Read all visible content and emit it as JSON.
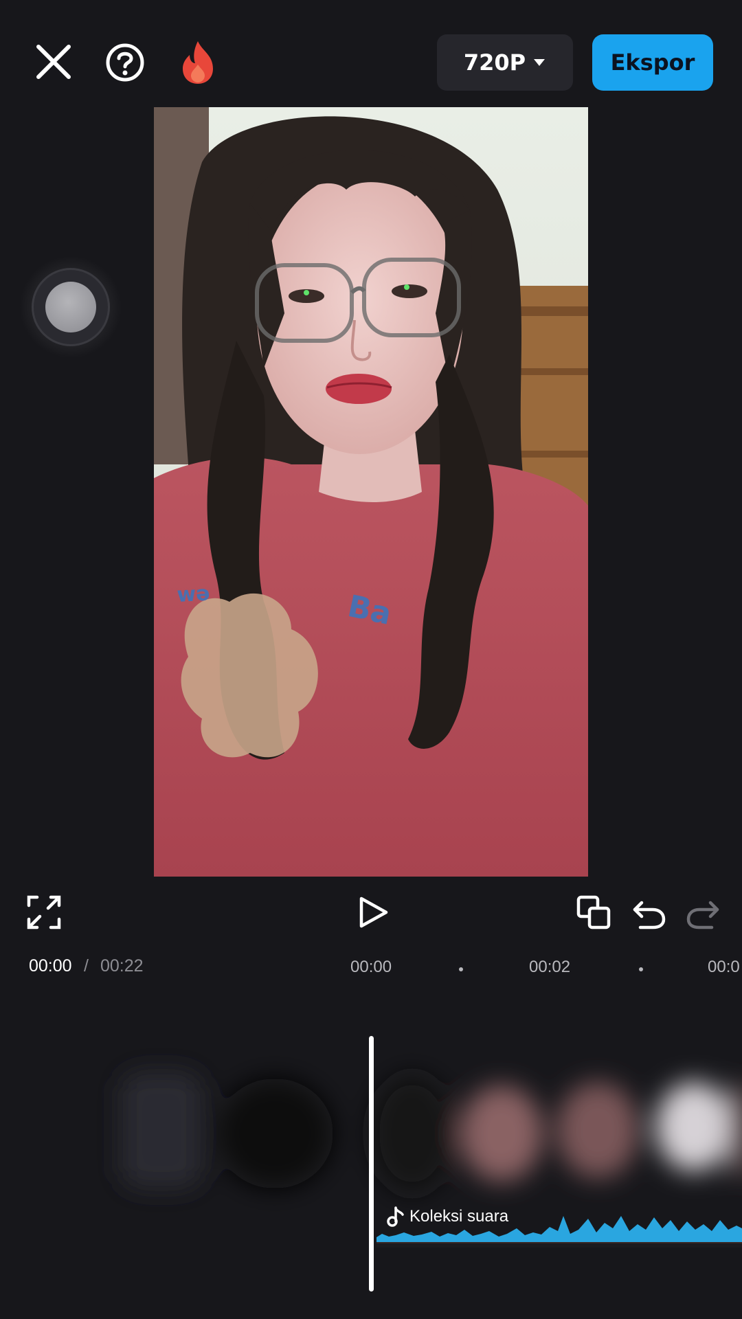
{
  "toolbar": {
    "resolution_label": "720P",
    "export_label": "Ekspor"
  },
  "icons": {
    "close": "close-icon",
    "help": "help-icon",
    "flame": "flame-icon",
    "dropdown": "chevron-down-icon",
    "fullscreen": "fullscreen-icon",
    "play": "play-icon",
    "copy": "copy-icon",
    "undo": "undo-icon",
    "redo": "redo-icon",
    "audio": "music-note-icon"
  },
  "time": {
    "current": "00:00",
    "separator": "/",
    "total": "00:22"
  },
  "ruler": {
    "ticks": [
      "00:00",
      "00:02",
      "00:0"
    ]
  },
  "timeline": {
    "audio_track_label": "Koleksi suara"
  },
  "colors": {
    "accent": "#1aa3ee",
    "background": "#17171b",
    "waveform": "#2aa6e0",
    "flame": "#e8473a"
  }
}
